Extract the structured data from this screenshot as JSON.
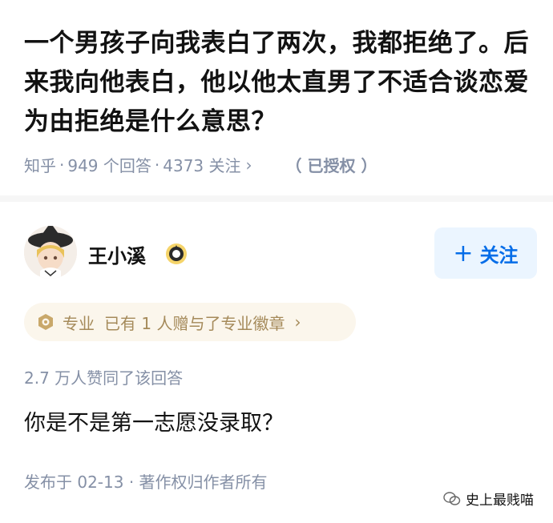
{
  "question": {
    "title": "一个男孩子向我表白了两次，我都拒绝了。后来我向他表白，他以他太直男了不适合谈恋爱为由拒绝是什么意思？",
    "platform": "知乎",
    "answers": "949 个回答",
    "follows": "4373 关注",
    "chevron": "›",
    "authorized": "（ 已授权 ）"
  },
  "author": {
    "name": "王小溪",
    "badge_icon": "creator-level-badge-icon",
    "follow_label": "关注",
    "follow_plus": "+"
  },
  "badge": {
    "label": "专业",
    "text": "已有 1 人赠与了专业徽章",
    "chevron": "›"
  },
  "answer": {
    "agree_text": "2.7 万人赞同了该回答",
    "content": "你是不是第一志愿没录取？",
    "footer": "发布于 02-13 · 著作权归作者所有"
  },
  "watermark": {
    "text": "史上最贱喵"
  },
  "colors": {
    "accent": "#056de8",
    "meta": "#8590a6",
    "badge_bg": "#fbf6ec",
    "badge_fg": "#a58a5a"
  }
}
